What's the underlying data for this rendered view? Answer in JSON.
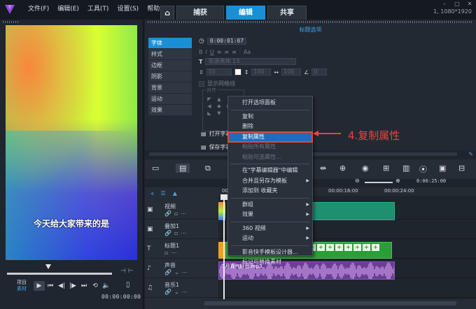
{
  "app": {
    "menus": [
      "文件(F)",
      "编辑(E)",
      "工具(T)",
      "设置(S)",
      "帮助(H)"
    ],
    "tabs": {
      "home_icon": "⌂",
      "capture": "捕获",
      "edit": "编辑",
      "share": "共享"
    },
    "resolution": "1, 1080*1920",
    "accent": "#1b8fd6"
  },
  "preview": {
    "subtitle": "今天给大家带来的是",
    "mode_project": "项目",
    "mode_clip": "素材",
    "timecode": "00:00:00:00"
  },
  "options": {
    "title": "标题选项",
    "side_tabs": [
      "字体",
      "样式",
      "边框",
      "阴影",
      "背景",
      "运动",
      "效果"
    ],
    "time_value": "0:00:01:07",
    "font_placeholder": "思源黑体 13",
    "size_value": "55",
    "line_value": "100",
    "tracking_value": "100",
    "angle_value": "0",
    "show_grid": "显示网格线",
    "align_label": "对齐",
    "open_button": "打开字幕文件",
    "save_button": "保存字幕文件"
  },
  "timeline": {
    "ruler": [
      "00:00:00:00",
      "00:00:16:00",
      "00:00:24:00"
    ],
    "zoom_time": "0:00:25:00",
    "tracks": [
      {
        "name": "视频",
        "icon": "▣"
      },
      {
        "name": "叠加1",
        "icon": "▣"
      },
      {
        "name": "标题1",
        "icon": "T"
      },
      {
        "name": "声音",
        "icon": "♪"
      },
      {
        "name": "音乐1",
        "icon": "♫"
      }
    ],
    "audio_clip_label": "1月真气好音.mp3"
  },
  "context_menu": {
    "items": [
      {
        "label": "打开选项面板",
        "state": "normal"
      },
      {
        "sep": true
      },
      {
        "label": "复制",
        "state": "normal"
      },
      {
        "label": "删除",
        "state": "normal"
      },
      {
        "label": "复制属性",
        "state": "highlighted"
      },
      {
        "label": "粘贴所有属性",
        "state": "disabled"
      },
      {
        "label": "粘贴可选属性...",
        "state": "disabled"
      },
      {
        "sep": true
      },
      {
        "label": "在\"字幕编辑器\"中编辑",
        "state": "normal"
      },
      {
        "label": "合并且另存为模板",
        "state": "normal",
        "submenu": true
      },
      {
        "label": "添加到 收藏夹",
        "state": "normal"
      },
      {
        "sep": true
      },
      {
        "label": "群组",
        "state": "normal",
        "submenu": true
      },
      {
        "label": "效果",
        "state": "normal",
        "submenu": true
      },
      {
        "sep": true
      },
      {
        "label": "360 视频",
        "state": "normal",
        "submenu": true
      },
      {
        "label": "运动",
        "state": "normal",
        "submenu": true
      },
      {
        "sep": true
      },
      {
        "label": "影音快手模板设计器...",
        "state": "normal"
      },
      {
        "label": "标记可替换素材",
        "state": "normal"
      }
    ]
  },
  "annotation": {
    "text": "4.复制属性",
    "color": "#e6453c"
  }
}
